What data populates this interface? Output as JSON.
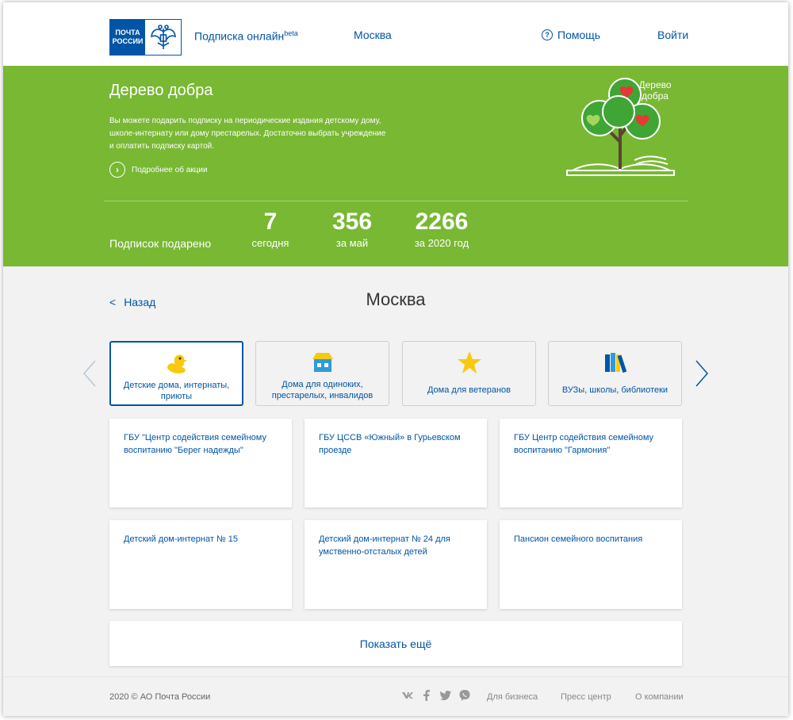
{
  "header": {
    "logo_line1": "ПОЧТА",
    "logo_line2": "РОССИИ",
    "brand": "Подписка онлайн",
    "brand_sup": "beta",
    "city": "Москва",
    "help": "Помощь",
    "login": "Войти"
  },
  "banner": {
    "title": "Дерево добра",
    "description": "Вы можете подарить подписку на периодические издания детскому дому, школе-интернату или дому престарелых. Достаточно выбрать учреждение и оплатить подписку картой.",
    "more_link": "Подробнее об акции",
    "tree_label_1": "Дерево",
    "tree_label_2": "добра",
    "stats_label": "Подписок подарено",
    "stats": [
      {
        "value": "7",
        "caption": "сегодня"
      },
      {
        "value": "356",
        "caption": "за май"
      },
      {
        "value": "2266",
        "caption": "за 2020 год"
      }
    ]
  },
  "main": {
    "back": "Назад",
    "back_arrow": "<",
    "title": "Москва",
    "categories": [
      {
        "label": "Детские дома, интернаты, приюты",
        "icon": "duck-icon",
        "active": true
      },
      {
        "label": "Дома для одиноких, престарелых, инвалидов",
        "icon": "house-icon",
        "active": false
      },
      {
        "label": "Дома для ветеранов",
        "icon": "star-icon",
        "active": false
      },
      {
        "label": "ВУЗы, школы, библиотеки",
        "icon": "books-icon",
        "active": false
      }
    ],
    "institutions": [
      "ГБУ \"Центр содействия семейному воспитанию \"Берег надежды\"",
      "ГБУ ЦССВ «Южный» в Гурьевском проезде",
      "ГБУ Центр содействия семейному воспитанию \"Гармония\"",
      "Детский дом-интернат № 15",
      "Детский дом-интернат № 24 для умственно-отсталых детей",
      "Пансион семейного воспитания"
    ],
    "show_more": "Показать ещё"
  },
  "footer": {
    "copyright": "2020 © АО Почта России",
    "social": [
      "vk-icon",
      "facebook-icon",
      "twitter-icon",
      "viber-icon"
    ],
    "links": [
      "Для бизнеса",
      "Пресс центр",
      "О компании"
    ]
  },
  "colors": {
    "brand_blue": "#0055a6",
    "banner_green": "#78b833",
    "background": "#f2f2f2"
  }
}
